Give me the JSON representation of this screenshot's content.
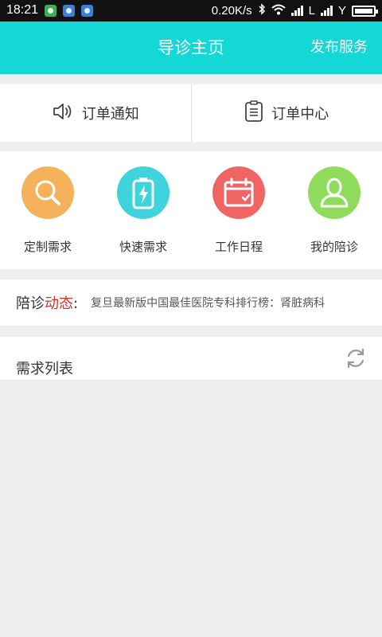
{
  "status_bar": {
    "time": "18:21",
    "speed": "0.20K/s",
    "carrier1": "L",
    "carrier2": "Y"
  },
  "header": {
    "title": "导诊主页",
    "action": "发布服务",
    "bg_color": "#14d8d6"
  },
  "order_bar": {
    "items": [
      {
        "label": "订单通知",
        "icon": "speaker-icon"
      },
      {
        "label": "订单中心",
        "icon": "clipboard-list-icon"
      }
    ]
  },
  "quick_actions": [
    {
      "label": "定制需求",
      "icon": "search-icon",
      "color": "#f5b25a"
    },
    {
      "label": "快速需求",
      "icon": "battery-bolt-icon",
      "color": "#3fd3dc"
    },
    {
      "label": "工作日程",
      "icon": "calendar-icon",
      "color": "#f06463"
    },
    {
      "label": "我的陪诊",
      "icon": "person-icon",
      "color": "#8fdc5c"
    }
  ],
  "news": {
    "label_prefix": "陪诊",
    "label_highlight": "动态",
    "label_suffix": ":",
    "text": "复旦最新版中国最佳医院专科排行榜：肾脏病科"
  },
  "list": {
    "title": "需求列表"
  }
}
